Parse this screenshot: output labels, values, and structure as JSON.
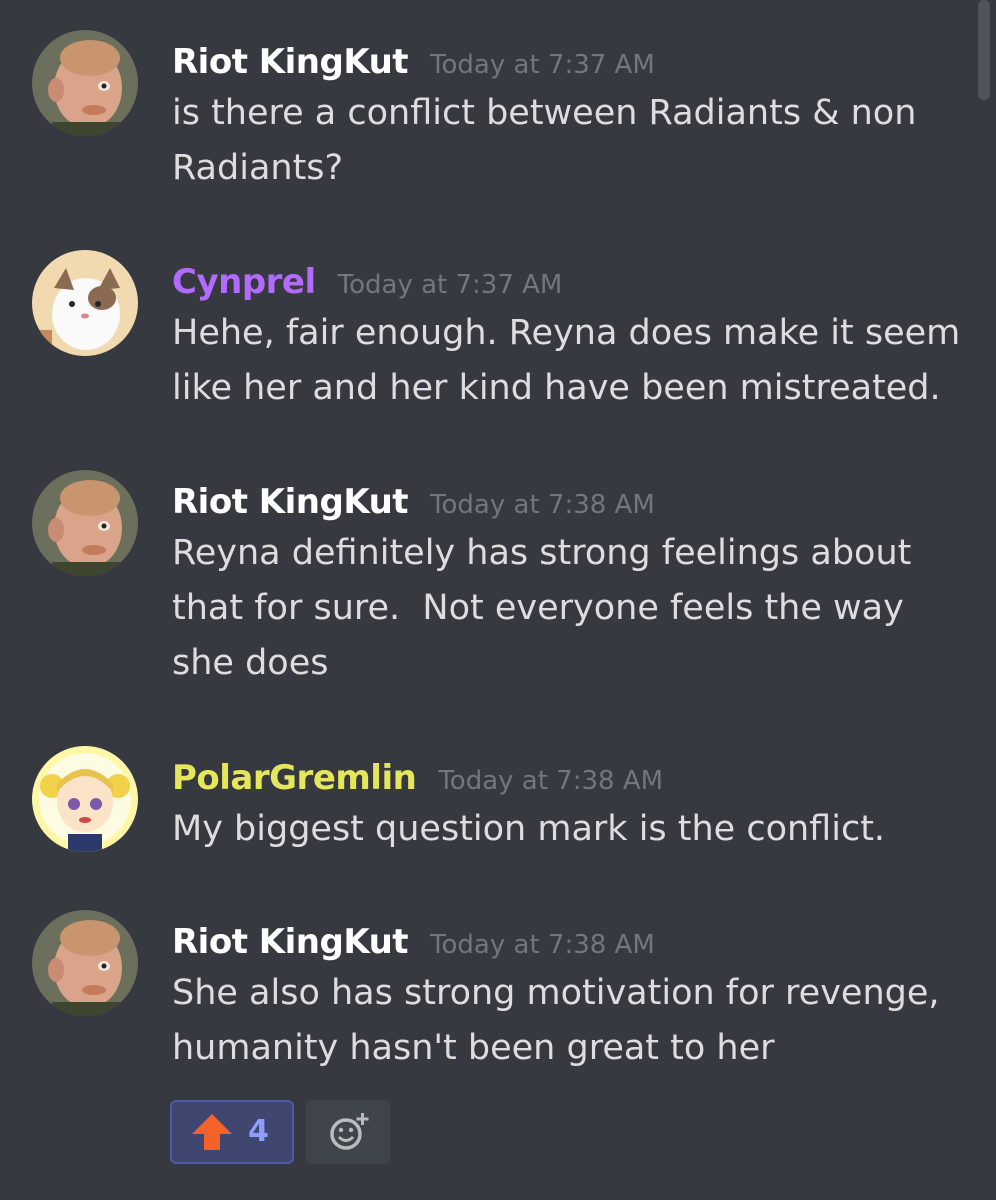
{
  "messages": [
    {
      "username": "Riot KingKut",
      "username_color": "#ffffff",
      "timestamp": "Today at 7:37 AM",
      "text": "is there a conflict between Radiants & non\nRadiants?"
    },
    {
      "username": "Cynprel",
      "username_color": "#b36aff",
      "timestamp": "Today at 7:37 AM",
      "text": "Hehe, fair enough. Reyna does make it seem\nlike her and her kind have been mistreated."
    },
    {
      "username": "Riot KingKut",
      "username_color": "#ffffff",
      "timestamp": "Today at 7:38 AM",
      "text": "Reyna definitely has strong feelings about\nthat for sure.  Not everyone feels the way\nshe does"
    },
    {
      "username": "PolarGremlin",
      "username_color": "#e6e65a",
      "timestamp": "Today at 7:38 AM",
      "text": "My biggest question mark is the conflict."
    },
    {
      "username": "Riot KingKut",
      "username_color": "#ffffff",
      "timestamp": "Today at 7:38 AM",
      "text": "She also has strong motivation for revenge,\nhumanity hasn't been great to her",
      "reactions": [
        {
          "emoji": "arrow-up-emoji",
          "count": "4"
        }
      ]
    }
  ],
  "icons": {
    "upvote": "arrow-up-emoji",
    "add_reaction": "add-reaction-icon"
  },
  "colors": {
    "background": "#36393f",
    "timestamp": "#72767d",
    "text": "#dcddde",
    "reaction_bg": "#3f4770",
    "reaction_count": "#8e9bff"
  }
}
